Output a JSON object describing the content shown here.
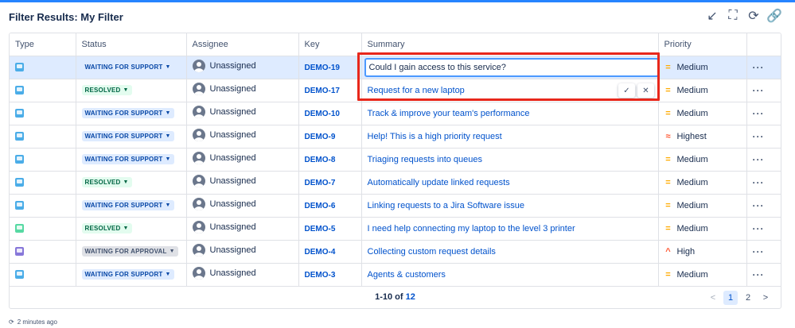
{
  "gadget": {
    "title": "Filter Results: My Filter",
    "actions": [
      {
        "icon": "minimize-icon",
        "glyph": "↙"
      },
      {
        "icon": "fullscreen-icon",
        "glyph": "⛶"
      },
      {
        "icon": "refresh-icon",
        "glyph": "⟳"
      },
      {
        "icon": "link-icon",
        "glyph": "🔗"
      }
    ]
  },
  "columns": [
    "Type",
    "Status",
    "Assignee",
    "Key",
    "Summary",
    "Priority",
    ""
  ],
  "rows": [
    {
      "type_color": "#4bade8",
      "type_icon": "service-request-icon",
      "status": "WAITING FOR SUPPORT",
      "status_kind": "support",
      "assignee": "Unassigned",
      "key": "DEMO-19",
      "summary": "Could I gain access to this service?",
      "priority": "Medium",
      "priority_icon": "=",
      "priority_color": "#ffab00"
    },
    {
      "type_color": "#4bade8",
      "type_icon": "service-request-icon",
      "status": "RESOLVED",
      "status_kind": "resolved",
      "assignee": "Unassigned",
      "key": "DEMO-17",
      "summary": "Request for a new laptop",
      "priority": "Medium",
      "priority_icon": "=",
      "priority_color": "#ffab00"
    },
    {
      "type_color": "#4bade8",
      "type_icon": "service-request-icon",
      "status": "WAITING FOR SUPPORT",
      "status_kind": "support",
      "assignee": "Unassigned",
      "key": "DEMO-10",
      "summary": "Track & improve your team's performance",
      "priority": "Medium",
      "priority_icon": "=",
      "priority_color": "#ffab00"
    },
    {
      "type_color": "#4bade8",
      "type_icon": "service-request-icon",
      "status": "WAITING FOR SUPPORT",
      "status_kind": "support",
      "assignee": "Unassigned",
      "key": "DEMO-9",
      "summary": "Help! This is a high priority request",
      "priority": "Highest",
      "priority_icon": "≈",
      "priority_color": "#ff5630"
    },
    {
      "type_color": "#4bade8",
      "type_icon": "service-request-icon",
      "status": "WAITING FOR SUPPORT",
      "status_kind": "support",
      "assignee": "Unassigned",
      "key": "DEMO-8",
      "summary": "Triaging requests into queues",
      "priority": "Medium",
      "priority_icon": "=",
      "priority_color": "#ffab00"
    },
    {
      "type_color": "#4bade8",
      "type_icon": "service-request-icon",
      "status": "RESOLVED",
      "status_kind": "resolved",
      "assignee": "Unassigned",
      "key": "DEMO-7",
      "summary": "Automatically update linked requests",
      "priority": "Medium",
      "priority_icon": "=",
      "priority_color": "#ffab00"
    },
    {
      "type_color": "#4bade8",
      "type_icon": "service-request-icon",
      "status": "WAITING FOR SUPPORT",
      "status_kind": "support",
      "assignee": "Unassigned",
      "key": "DEMO-6",
      "summary": "Linking requests to a Jira Software issue",
      "priority": "Medium",
      "priority_icon": "=",
      "priority_color": "#ffab00"
    },
    {
      "type_color": "#57d9a3",
      "type_icon": "ask-question-icon",
      "status": "RESOLVED",
      "status_kind": "resolved",
      "assignee": "Unassigned",
      "key": "DEMO-5",
      "summary": "I need help connecting my laptop to the level 3 printer",
      "priority": "Medium",
      "priority_icon": "=",
      "priority_color": "#ffab00"
    },
    {
      "type_color": "#8777d9",
      "type_icon": "change-request-icon",
      "status": "WAITING FOR APPROVAL",
      "status_kind": "approval",
      "assignee": "Unassigned",
      "key": "DEMO-4",
      "summary": "Collecting custom request details",
      "priority": "High",
      "priority_icon": "^",
      "priority_color": "#ff5630"
    },
    {
      "type_color": "#4bade8",
      "type_icon": "service-request-icon",
      "status": "WAITING FOR SUPPORT",
      "status_kind": "support",
      "assignee": "Unassigned",
      "key": "DEMO-3",
      "summary": "Agents & customers",
      "priority": "Medium",
      "priority_icon": "=",
      "priority_color": "#ffab00"
    }
  ],
  "editing": {
    "value": "Could I gain access to this service?",
    "confirm_glyph": "✓",
    "cancel_glyph": "✕"
  },
  "pagination": {
    "range": "1-10 of ",
    "total": "12",
    "prev": "<",
    "pages": [
      "1",
      "2"
    ],
    "current": "1",
    "next": ">"
  },
  "footer": {
    "refresh_glyph": "⟳",
    "updated": "2 minutes ago"
  },
  "colors": {
    "accent": "#0052cc",
    "highlight": "#e8271b",
    "selected_row": "#deebff"
  }
}
